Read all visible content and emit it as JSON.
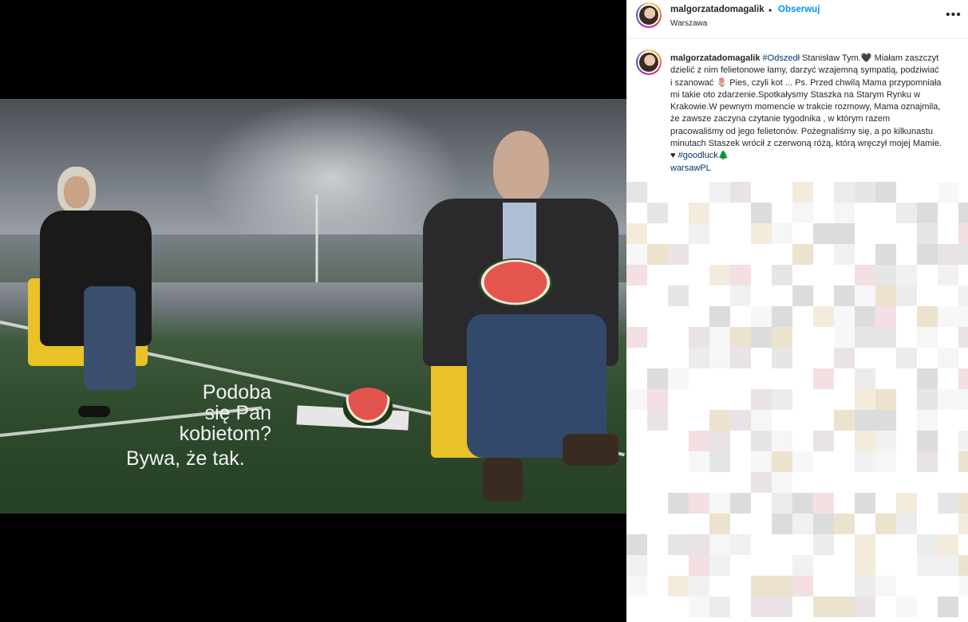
{
  "post": {
    "username": "malgorzatadomagalik",
    "separator": "•",
    "follow_label": "Obserwuj",
    "location": "Warszawa",
    "more_label": "•••"
  },
  "image": {
    "caption_line1": "Podoba",
    "caption_line2": "się Pan",
    "caption_line3": "kobietom?",
    "caption_line4": "Bywa, że tak."
  },
  "comment": {
    "username": "malgorzatadomagalik",
    "hashtag1": "#Odszedł",
    "text1": " Stanisław Tym.🖤 Miałam zaszczyt dzielić z nim felietonowe łamy, darzyć wzajemną sympatią, podziwiać i szanować 🌷 Pies, czyli kot ... Ps. Przed chwilą Mama przypomniała mi takie oto zdarzenie.Spotkałysmy Staszka na Starym Rynku w Krakowie.W pewnym momencie w trakcie rozmowy, Mama oznajmila, że zawsze zaczyna czytanie tygodnika , w którym razem pracowaliśmy od jego felietonów. Pożegnaliśmy się, a po kilkunastu minutach Staszek wrócił z czerwoną różą, którą wręczył mojej Mamie. ♥ ",
    "hashtag2": "#goodluck🌲",
    "watermark": "warsawPL"
  },
  "colors": {
    "follow": "#0095f6",
    "hashtag": "#00376b",
    "chair": "#e8c226"
  }
}
